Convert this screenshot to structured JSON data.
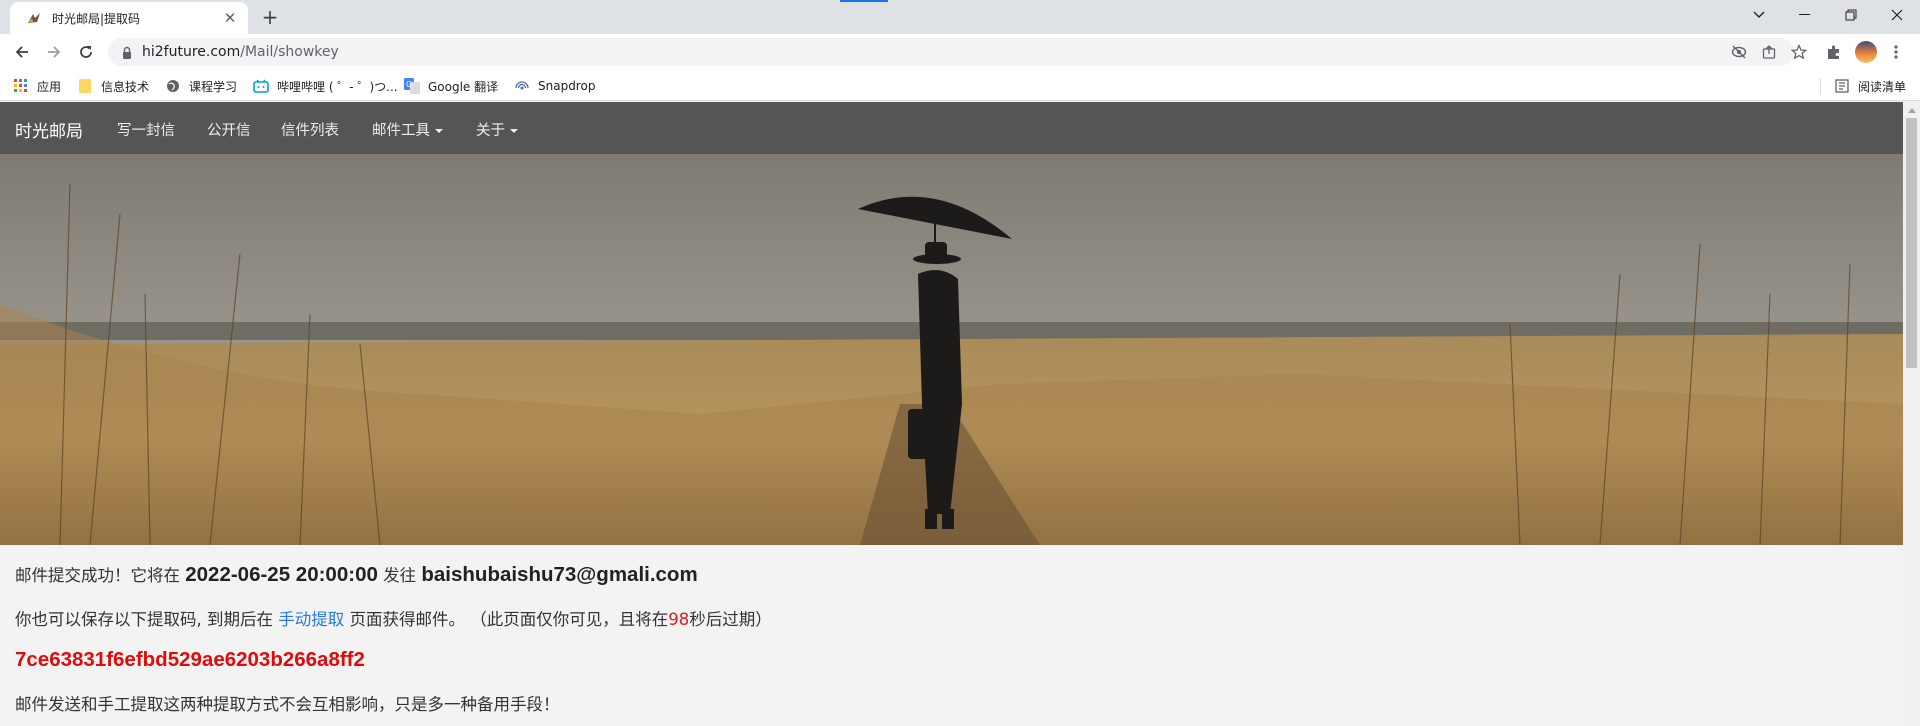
{
  "browser": {
    "tab_title": "时光邮局|提取码",
    "url_domain": "hi2future.com",
    "url_path": "/Mail/showkey",
    "accent_color": "#1a73e8"
  },
  "bookmarks": [
    {
      "label": "应用",
      "icon": "apps-grid-icon"
    },
    {
      "label": "信息技术",
      "icon": "folder-icon"
    },
    {
      "label": "课程学习",
      "icon": "globe-icon"
    },
    {
      "label": "哔哩哔哩 ( ゜- ゜)つ...",
      "icon": "bilibili-icon"
    },
    {
      "label": "Google 翻译",
      "icon": "google-translate-icon"
    },
    {
      "label": "Snapdrop",
      "icon": "snapdrop-icon"
    },
    {
      "label": "阅读清单",
      "icon": "reading-list-icon"
    }
  ],
  "site_nav": {
    "brand": "时光邮局",
    "links": [
      "写一封信",
      "公开信",
      "信件列表",
      "邮件工具",
      "关于"
    ],
    "background": "#555555"
  },
  "message": {
    "line1_prefix": "邮件提交成功！它将在 ",
    "send_time": "2022-06-25 20:00:00",
    "line1_mid": " 发往 ",
    "email": "baishubaishu73@gmali.com",
    "line2_prefix": "你也可以保存以下提取码, 到期后在 ",
    "manual_link": "手动提取",
    "line2_mid": " 页面获得邮件。 （此页面仅你可见，且将在",
    "countdown": "98",
    "line2_suffix": "秒后过期）",
    "key_code": "7ce63831f6efbd529ae6203b266a8ff2",
    "line4": "邮件发送和手工提取这两种提取方式不会互相影响，只是多一种备用手段！",
    "code_color": "#e00b0b",
    "link_color": "#2a7ae2"
  }
}
